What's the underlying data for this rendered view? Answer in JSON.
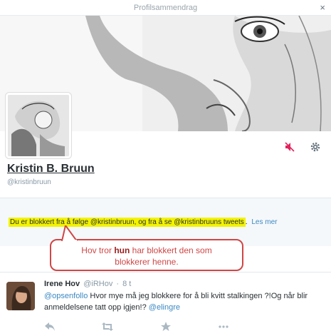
{
  "modal": {
    "title": "Profilsammendrag",
    "close_glyph": "×"
  },
  "profile": {
    "full_name": "Kristin B. Bruun",
    "screen_name": "@kristinbruun",
    "actions": [
      "muted-icon",
      "gear-icon"
    ]
  },
  "blocked_notice": {
    "text": "Du er blokkert fra å følge @kristinbruun, og fra å se @kristinbruuns tweets",
    "trailing": ".",
    "learn_more": "Les mer"
  },
  "annotation": {
    "before": "Hov tror ",
    "bold": "hun",
    "after": " har blokkert den som",
    "line2": "blokkerer henne."
  },
  "tweet": {
    "author": "Irene Hov",
    "handle": "@iRHov",
    "separator": "·",
    "time": "8 t",
    "mention1": "@opsenfollo",
    "text1": " Hvor mye må jeg blokkere for å bli kvitt stalkingen ?!Og når blir anmeldelsene tatt opp igjen!? ",
    "mention2": "@elingre",
    "actions": [
      "reply-icon",
      "retweet-icon",
      "favorite-icon",
      "more-icon"
    ]
  },
  "colors": {
    "accent": "#3b88c3",
    "highlight": "#f3f300",
    "callout": "#d04646",
    "muted_red": "#e0245e"
  }
}
